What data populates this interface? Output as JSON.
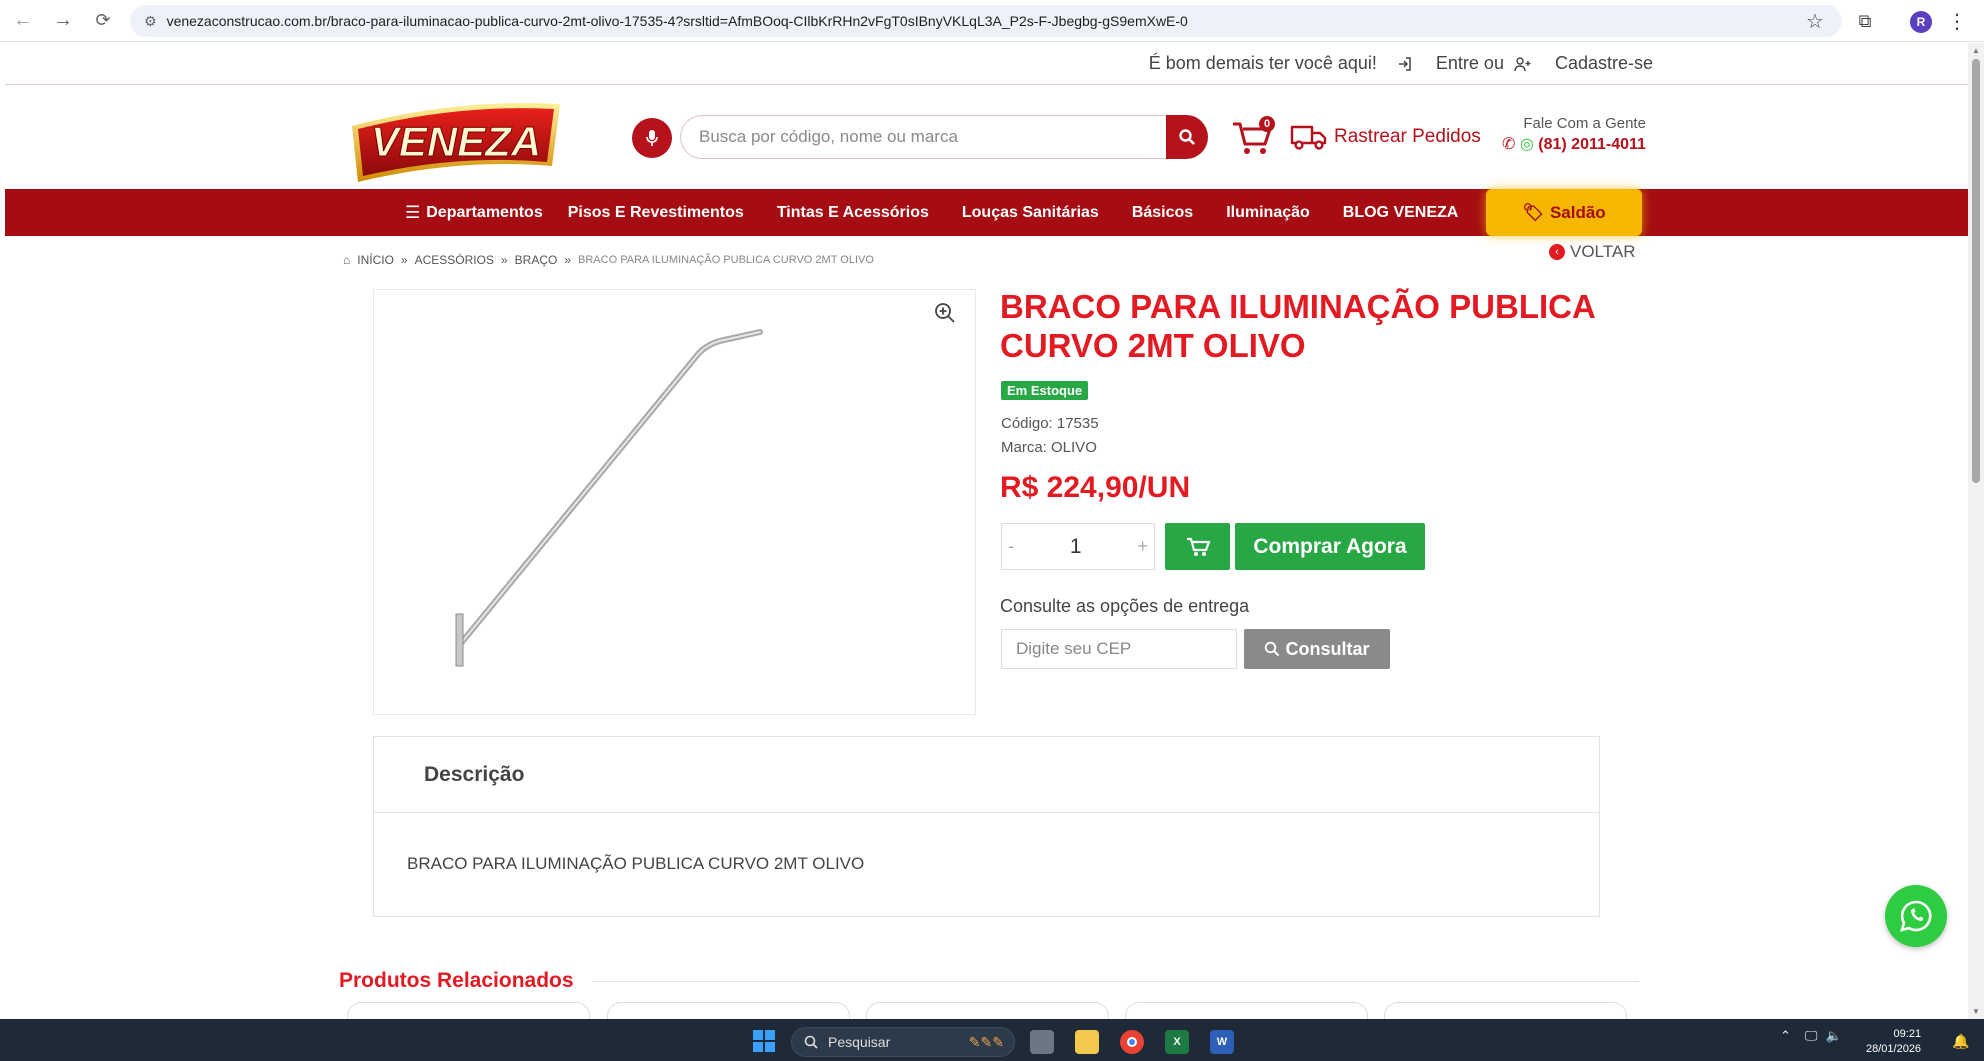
{
  "browser": {
    "url": "venezaconstrucao.com.br/braco-para-iluminacao-publica-curvo-2mt-olivo-17535-4?srsltid=AfmBOoq-CIlbKrRHn2vFgT0sIBnyVKLqL3A_P2s-F-Jbegbg-gS9emXwE-0",
    "profile_initial": "R"
  },
  "topbar": {
    "welcome": "É bom demais ter você aqui!",
    "login": "Entre ou",
    "signup": "Cadastre-se"
  },
  "header": {
    "logo_text": "VENEZA",
    "search_placeholder": "Busca por código, nome ou marca",
    "cart_count": "0",
    "track_orders": "Rastrear Pedidos",
    "contact_title": "Fale Com a Gente",
    "contact_phone": "(81) 2011-4011"
  },
  "nav": {
    "departments": "Departamentos",
    "items": [
      "Pisos E Revestimentos",
      "Tintas E Acessórios",
      "Louças Sanitárias",
      "Básicos",
      "Iluminação",
      "BLOG VENEZA"
    ],
    "sale": "Saldão"
  },
  "breadcrumb": {
    "items": [
      "INÍCIO",
      "ACESSÓRIOS",
      "BRAÇO",
      "BRACO PARA ILUMINAÇÃO PUBLICA CURVO 2MT OLIVO"
    ],
    "back": "VOLTAR"
  },
  "product": {
    "title": "BRACO PARA ILUMINAÇÃO PUBLICA CURVO 2MT OLIVO",
    "stock": "Em Estoque",
    "code": "Código: 17535",
    "brand": "Marca: OLIVO",
    "price": "R$ 224,90/UN",
    "quantity": "1",
    "qty_minus": "-",
    "qty_plus": "+",
    "buy_now": "Comprar Agora",
    "shipping_label": "Consulte as opções de entrega",
    "cep_placeholder": "Digite seu CEP",
    "consult": "Consultar"
  },
  "description": {
    "heading": "Descrição",
    "text": "BRACO PARA ILUMINAÇÃO PUBLICA CURVO 2MT OLIVO"
  },
  "related": {
    "heading": "Produtos Relacionados"
  },
  "taskbar": {
    "search": "Pesquisar",
    "time": "09:21",
    "date": "28/01/2026"
  },
  "colors": {
    "brand_red": "#a50d12",
    "accent_red": "#e21b23",
    "sale_yellow": "#f5b700",
    "success_green": "#28a745"
  }
}
